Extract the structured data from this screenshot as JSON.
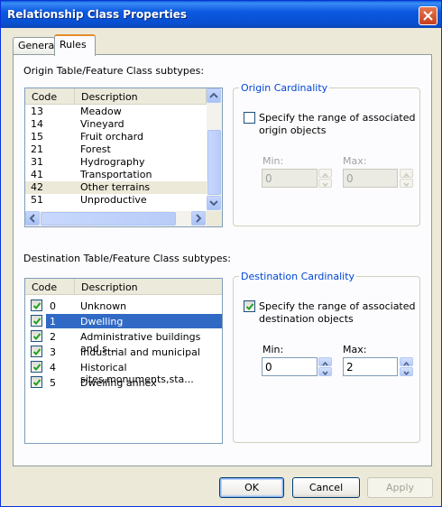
{
  "window": {
    "title": "Relationship Class Properties"
  },
  "tabs": [
    {
      "label": "General"
    },
    {
      "label": "Rules"
    }
  ],
  "origin": {
    "label": "Origin Table/Feature Class subtypes:",
    "columns": [
      "Code",
      "Description"
    ],
    "rows": [
      {
        "code": "13",
        "desc": "Meadow"
      },
      {
        "code": "14",
        "desc": "Vineyard"
      },
      {
        "code": "15",
        "desc": "Fruit orchard"
      },
      {
        "code": "21",
        "desc": "Forest"
      },
      {
        "code": "31",
        "desc": "Hydrography"
      },
      {
        "code": "41",
        "desc": "Transportation"
      },
      {
        "code": "42",
        "desc": "Other terrains"
      },
      {
        "code": "51",
        "desc": "Unproductive"
      }
    ],
    "highlighted_code": "42"
  },
  "origin_cardinality": {
    "title": "Origin Cardinality",
    "checkbox_label_1": "Specify the range of associated",
    "checkbox_label_2": "origin objects",
    "checked": false,
    "min_label": "Min:",
    "max_label": "Max:",
    "min_value": "0",
    "max_value": "0",
    "enabled": false
  },
  "destination": {
    "label": "Destination Table/Feature Class subtypes:",
    "columns": [
      "Code",
      "Description"
    ],
    "rows": [
      {
        "code": "0",
        "desc": "Unknown",
        "checked": true
      },
      {
        "code": "1",
        "desc": "Dwelling",
        "checked": true
      },
      {
        "code": "2",
        "desc": "Administrative buildings and s...",
        "checked": true
      },
      {
        "code": "3",
        "desc": "Industrial and municipal",
        "checked": true
      },
      {
        "code": "4",
        "desc": "Historical sites,monuments,sta...",
        "checked": true
      },
      {
        "code": "5",
        "desc": "Dwelling annex",
        "checked": true
      }
    ],
    "selected_code": "1"
  },
  "destination_cardinality": {
    "title": "Destination Cardinality",
    "checkbox_label_1": "Specify the range of associated",
    "checkbox_label_2": "destination objects",
    "checked": true,
    "min_label": "Min:",
    "max_label": "Max:",
    "min_value": "0",
    "max_value": "2",
    "enabled": true
  },
  "buttons": {
    "ok": "OK",
    "cancel": "Cancel",
    "apply": "Apply"
  },
  "colors": {
    "titlebar": "#0a5fd8",
    "selection": "#316ac5",
    "groupbox_title": "#0046d5",
    "dialog_bg": "#ece9d8"
  }
}
